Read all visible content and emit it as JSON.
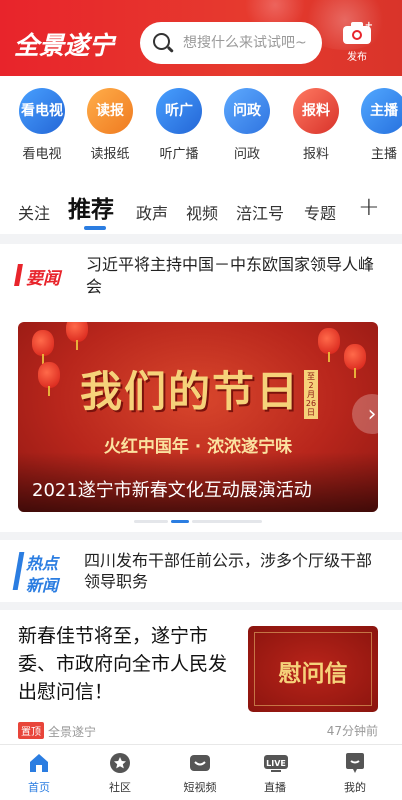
{
  "header": {
    "logo": "全景遂宁",
    "search_placeholder": "想搜什么来试试吧~",
    "publish_label": "发布"
  },
  "quick_links": [
    {
      "icon_text": "看电视",
      "circle_text": "看电\n视",
      "label": "看电视",
      "color": "#2f7fe8",
      "icon": "tv-icon"
    },
    {
      "icon_text": "读报",
      "circle_text": "读报",
      "label": "读报纸",
      "color": "#f0882c",
      "icon": "newspaper-icon"
    },
    {
      "icon_text": "听广",
      "circle_text": "听广\n播",
      "label": "听广播",
      "color": "#2f7fe8",
      "icon": "radio-icon"
    },
    {
      "icon_text": "问政",
      "circle_text": "问政",
      "label": "问政",
      "color": "#3a8df0",
      "icon": "politics-icon"
    },
    {
      "icon_text": "报料",
      "circle_text": "报料",
      "label": "报料",
      "color": "#e34a3c",
      "icon": "report-icon"
    },
    {
      "icon_text": "主播",
      "circle_text": "主播",
      "label": "主播",
      "color": "#2f8fe8",
      "icon": "anchor-icon"
    }
  ],
  "tabs": [
    {
      "label": "关注",
      "active": false
    },
    {
      "label": "推荐",
      "active": true
    },
    {
      "label": "政声",
      "active": false
    },
    {
      "label": "视频",
      "active": false
    },
    {
      "label": "涪江号",
      "active": false
    },
    {
      "label": "专题",
      "active": false
    }
  ],
  "tab_add": "+",
  "headline": {
    "tag": "要闻",
    "text": "习近平将主持中国－中东欧国家领导人峰会"
  },
  "banner": {
    "title": "我们的节日",
    "date_tag": "至2月26日",
    "slogan": "火红中国年 · 浓浓遂宁味",
    "caption": "2021遂宁市新春文化互动展演活动",
    "next": "›",
    "slide_count": 3,
    "active_slide": 2
  },
  "hot_news": {
    "tag_line1": "热点",
    "tag_line2": "新闻",
    "text": "四川发布干部任前公示，涉多个厅级干部领导职务"
  },
  "article": {
    "title": "新春佳节将至，遂宁市委、市政府向全市人民发出慰问信！",
    "thumb_text": "慰问信",
    "pin_badge": "置顶",
    "source": "全景遂宁",
    "time": "47分钟前"
  },
  "bottom_nav": [
    {
      "label": "首页",
      "icon": "home-icon",
      "active": true
    },
    {
      "label": "社区",
      "icon": "community-icon",
      "active": false
    },
    {
      "label": "短视频",
      "icon": "short-video-icon",
      "active": false
    },
    {
      "label": "直播",
      "icon": "live-icon",
      "active": false
    },
    {
      "label": "我的",
      "icon": "profile-icon",
      "active": false
    }
  ],
  "colors": {
    "brand_red": "#e8242b",
    "accent_blue": "#2b7de1"
  }
}
